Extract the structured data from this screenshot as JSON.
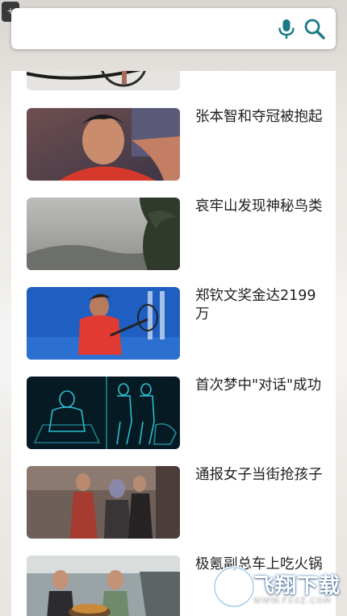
{
  "top_button": {
    "label": "+"
  },
  "search": {
    "value": "",
    "placeholder": "",
    "mic_icon": "microphone-icon",
    "search_icon": "magnifier-icon",
    "accent_color": "#1a7b83"
  },
  "feed": {
    "items": [
      {
        "title": "",
        "thumb": "bicycle-photo"
      },
      {
        "title": "张本智和夺冠被抱起",
        "thumb": "table-tennis-player-photo"
      },
      {
        "title": "哀牢山发现神秘鸟类",
        "thumb": "misty-forest-photo"
      },
      {
        "title": "郑钦文奖金达2199万",
        "thumb": "tennis-player-photo"
      },
      {
        "title": "首次梦中\"对话\"成功",
        "thumb": "hologram-bodies-photo"
      },
      {
        "title": "通报女子当街抢孩子",
        "thumb": "street-people-photo"
      },
      {
        "title": "极氪副总车上吃火锅",
        "thumb": "car-interior-photo"
      }
    ]
  },
  "watermark": {
    "text": "飞翔下载",
    "sub": "WWW.FXXZ.COM"
  }
}
